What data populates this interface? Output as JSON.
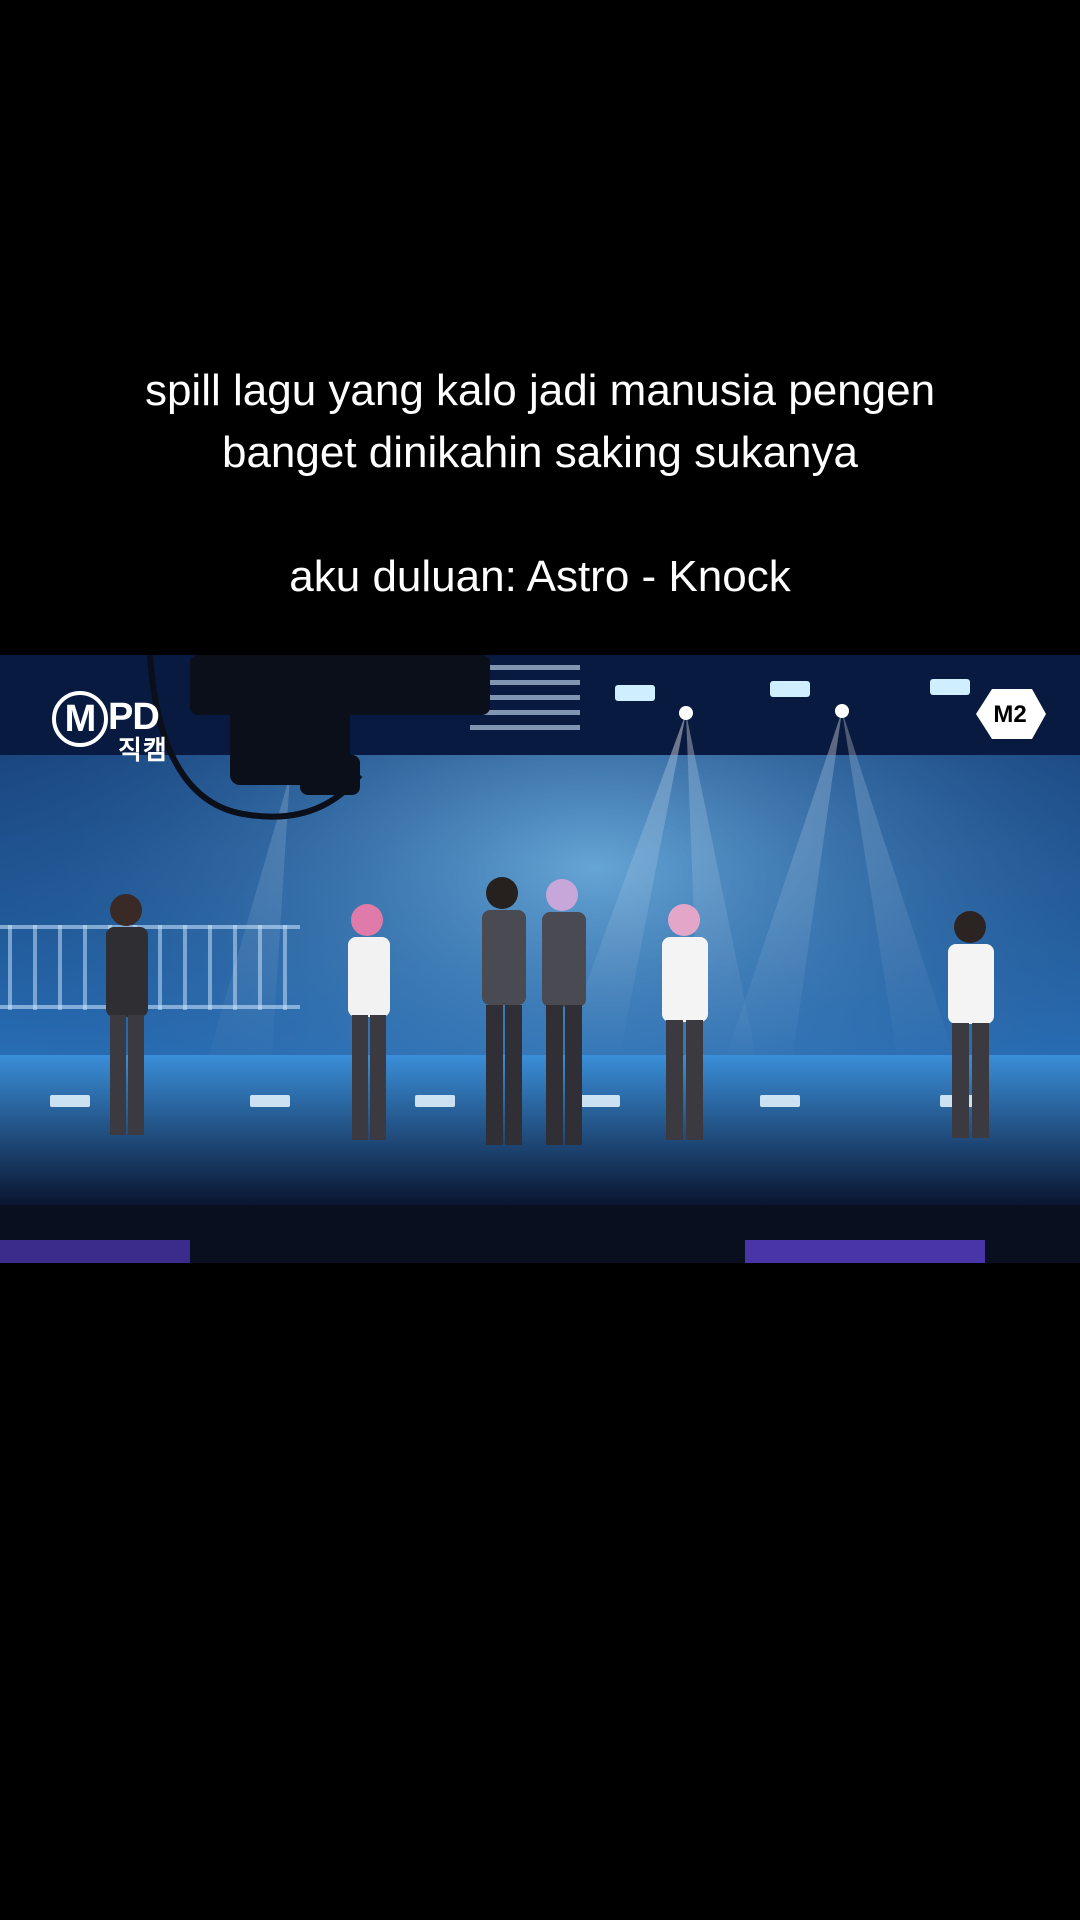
{
  "caption": {
    "line1": "spill lagu yang kalo jadi manusia pengen",
    "line2": "banget dinikahin saking sukanya",
    "line3": "aku duluan: Astro - Knock"
  },
  "video": {
    "logo_left_mark": "M",
    "logo_left_text": "PD",
    "logo_left_sub": "직캠",
    "logo_right_text": "M2"
  }
}
